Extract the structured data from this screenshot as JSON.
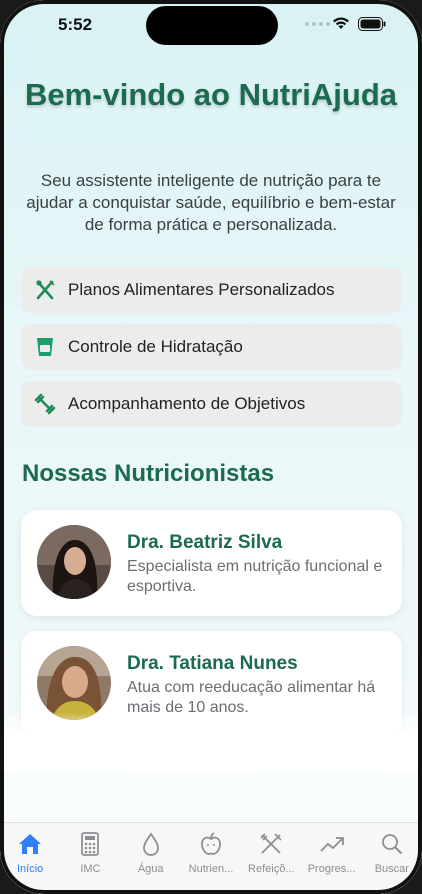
{
  "status_bar": {
    "time": "5:52"
  },
  "header": {
    "title": "Bem-vindo ao NutriAjuda",
    "subtitle": "Seu assistente inteligente de nutrição para te ajudar a conquistar saúde, equilíbrio e bem-estar de forma prática e personalizada."
  },
  "features": [
    {
      "label": "Planos Alimentares Personalizados",
      "icon": "fork-knife-icon"
    },
    {
      "label": "Controle de Hidratação",
      "icon": "water-cup-icon"
    },
    {
      "label": "Acompanhamento de Objetivos",
      "icon": "dumbbell-icon"
    }
  ],
  "nutritionists_section": {
    "title": "Nossas Nutricionistas"
  },
  "nutritionists": [
    {
      "name": "Dra. Beatriz Silva",
      "description": "Especialista em nutrição funcional e esportiva."
    },
    {
      "name": "Dra. Tatiana Nunes",
      "description": "Atua com reeducação alimentar há mais de 10 anos."
    }
  ],
  "tabs": [
    {
      "label": "Início",
      "icon": "home-icon",
      "active": true
    },
    {
      "label": "IMC",
      "icon": "calculator-icon",
      "active": false
    },
    {
      "label": "Água",
      "icon": "drop-icon",
      "active": false
    },
    {
      "label": "Nutrien...",
      "icon": "apple-icon",
      "active": false
    },
    {
      "label": "Refeiçõ...",
      "icon": "utensils-icon",
      "active": false
    },
    {
      "label": "Progres...",
      "icon": "trend-icon",
      "active": false
    },
    {
      "label": "Buscar",
      "icon": "search-icon",
      "active": false
    }
  ],
  "colors": {
    "accent": "#1b6b4f",
    "tab_active": "#2f7ff5",
    "tab_inactive": "#8e8e93"
  }
}
